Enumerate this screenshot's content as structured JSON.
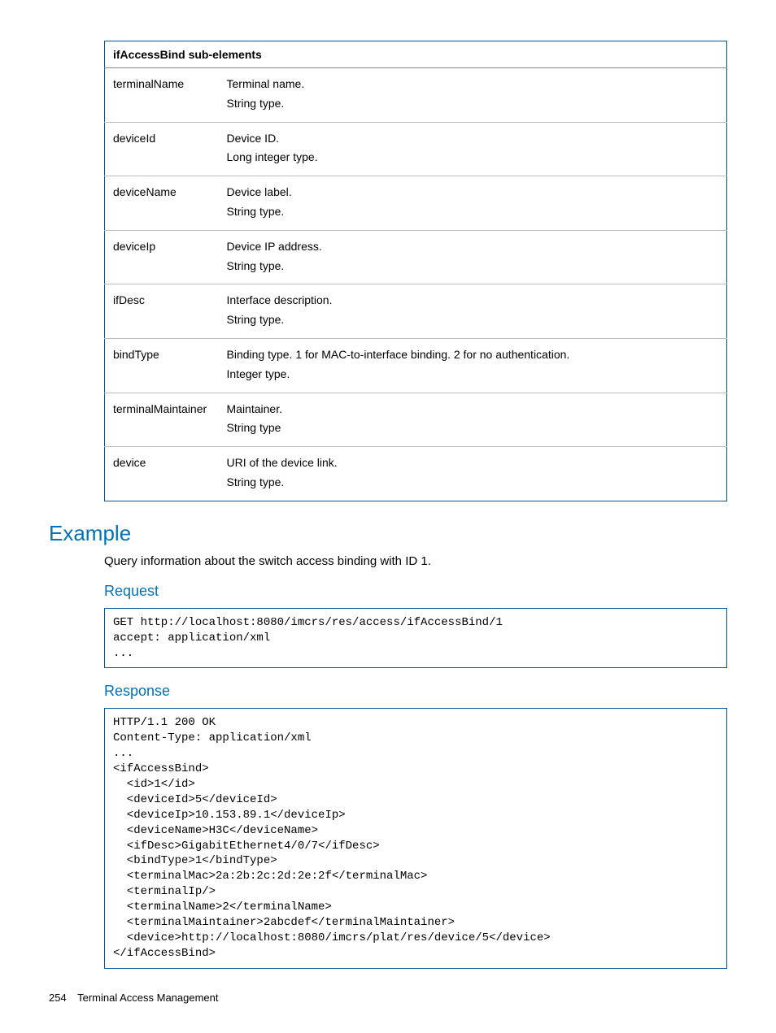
{
  "table": {
    "header": "ifAccessBind sub-elements",
    "rows": [
      {
        "name": "terminalName",
        "desc": "Terminal name.\nString type."
      },
      {
        "name": "deviceId",
        "desc": "Device ID.\nLong integer type."
      },
      {
        "name": "deviceName",
        "desc": "Device label.\nString type."
      },
      {
        "name": "deviceIp",
        "desc": "Device IP address.\nString type."
      },
      {
        "name": "ifDesc",
        "desc": "Interface description.\nString type."
      },
      {
        "name": "bindType",
        "desc": "Binding type. 1 for MAC-to-interface binding. 2 for no authentication.\nInteger type."
      },
      {
        "name": "terminalMaintainer",
        "desc": "Maintainer.\nString type"
      },
      {
        "name": "device",
        "desc": "URI of the device link.\nString type."
      }
    ]
  },
  "headings": {
    "example": "Example",
    "request": "Request",
    "response": "Response"
  },
  "example_intro": "Query information about the switch access binding with ID 1.",
  "request_code": "GET http://localhost:8080/imcrs/res/access/ifAccessBind/1\naccept: application/xml\n...",
  "response_code": "HTTP/1.1 200 OK\nContent-Type: application/xml\n...\n<ifAccessBind>\n  <id>1</id>\n  <deviceId>5</deviceId>\n  <deviceIp>10.153.89.1</deviceIp>\n  <deviceName>H3C</deviceName>\n  <ifDesc>GigabitEthernet4/0/7</ifDesc>\n  <bindType>1</bindType>\n  <terminalMac>2a:2b:2c:2d:2e:2f</terminalMac>\n  <terminalIp/>\n  <terminalName>2</terminalName>\n  <terminalMaintainer>2abcdef</terminalMaintainer>\n  <device>http://localhost:8080/imcrs/plat/res/device/5</device>\n</ifAccessBind>",
  "footer": {
    "page": "254",
    "title": "Terminal Access Management"
  }
}
